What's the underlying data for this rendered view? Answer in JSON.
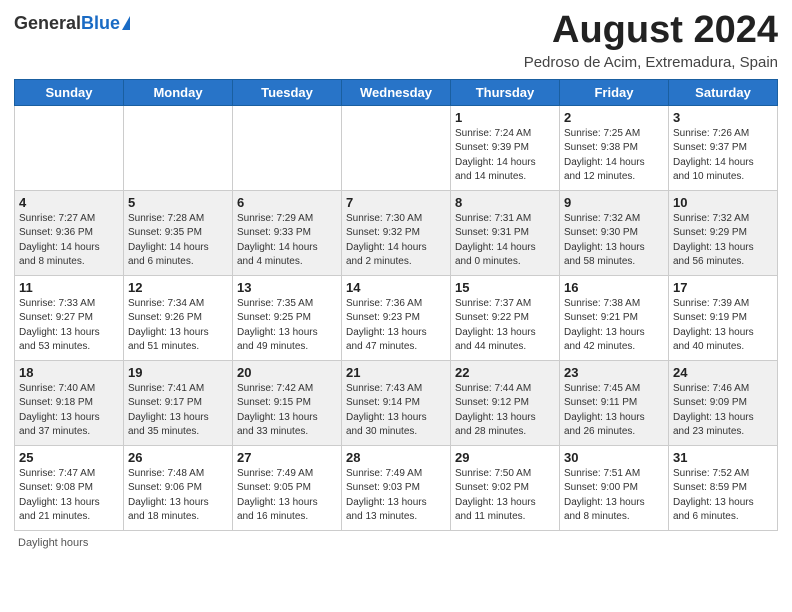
{
  "header": {
    "logo_general": "General",
    "logo_blue": "Blue",
    "month_title": "August 2024",
    "location": "Pedroso de Acim, Extremadura, Spain"
  },
  "days_of_week": [
    "Sunday",
    "Monday",
    "Tuesday",
    "Wednesday",
    "Thursday",
    "Friday",
    "Saturday"
  ],
  "footer": {
    "daylight_label": "Daylight hours"
  },
  "weeks": [
    [
      {
        "day": "",
        "info": ""
      },
      {
        "day": "",
        "info": ""
      },
      {
        "day": "",
        "info": ""
      },
      {
        "day": "",
        "info": ""
      },
      {
        "day": "1",
        "info": "Sunrise: 7:24 AM\nSunset: 9:39 PM\nDaylight: 14 hours\nand 14 minutes."
      },
      {
        "day": "2",
        "info": "Sunrise: 7:25 AM\nSunset: 9:38 PM\nDaylight: 14 hours\nand 12 minutes."
      },
      {
        "day": "3",
        "info": "Sunrise: 7:26 AM\nSunset: 9:37 PM\nDaylight: 14 hours\nand 10 minutes."
      }
    ],
    [
      {
        "day": "4",
        "info": "Sunrise: 7:27 AM\nSunset: 9:36 PM\nDaylight: 14 hours\nand 8 minutes."
      },
      {
        "day": "5",
        "info": "Sunrise: 7:28 AM\nSunset: 9:35 PM\nDaylight: 14 hours\nand 6 minutes."
      },
      {
        "day": "6",
        "info": "Sunrise: 7:29 AM\nSunset: 9:33 PM\nDaylight: 14 hours\nand 4 minutes."
      },
      {
        "day": "7",
        "info": "Sunrise: 7:30 AM\nSunset: 9:32 PM\nDaylight: 14 hours\nand 2 minutes."
      },
      {
        "day": "8",
        "info": "Sunrise: 7:31 AM\nSunset: 9:31 PM\nDaylight: 14 hours\nand 0 minutes."
      },
      {
        "day": "9",
        "info": "Sunrise: 7:32 AM\nSunset: 9:30 PM\nDaylight: 13 hours\nand 58 minutes."
      },
      {
        "day": "10",
        "info": "Sunrise: 7:32 AM\nSunset: 9:29 PM\nDaylight: 13 hours\nand 56 minutes."
      }
    ],
    [
      {
        "day": "11",
        "info": "Sunrise: 7:33 AM\nSunset: 9:27 PM\nDaylight: 13 hours\nand 53 minutes."
      },
      {
        "day": "12",
        "info": "Sunrise: 7:34 AM\nSunset: 9:26 PM\nDaylight: 13 hours\nand 51 minutes."
      },
      {
        "day": "13",
        "info": "Sunrise: 7:35 AM\nSunset: 9:25 PM\nDaylight: 13 hours\nand 49 minutes."
      },
      {
        "day": "14",
        "info": "Sunrise: 7:36 AM\nSunset: 9:23 PM\nDaylight: 13 hours\nand 47 minutes."
      },
      {
        "day": "15",
        "info": "Sunrise: 7:37 AM\nSunset: 9:22 PM\nDaylight: 13 hours\nand 44 minutes."
      },
      {
        "day": "16",
        "info": "Sunrise: 7:38 AM\nSunset: 9:21 PM\nDaylight: 13 hours\nand 42 minutes."
      },
      {
        "day": "17",
        "info": "Sunrise: 7:39 AM\nSunset: 9:19 PM\nDaylight: 13 hours\nand 40 minutes."
      }
    ],
    [
      {
        "day": "18",
        "info": "Sunrise: 7:40 AM\nSunset: 9:18 PM\nDaylight: 13 hours\nand 37 minutes."
      },
      {
        "day": "19",
        "info": "Sunrise: 7:41 AM\nSunset: 9:17 PM\nDaylight: 13 hours\nand 35 minutes."
      },
      {
        "day": "20",
        "info": "Sunrise: 7:42 AM\nSunset: 9:15 PM\nDaylight: 13 hours\nand 33 minutes."
      },
      {
        "day": "21",
        "info": "Sunrise: 7:43 AM\nSunset: 9:14 PM\nDaylight: 13 hours\nand 30 minutes."
      },
      {
        "day": "22",
        "info": "Sunrise: 7:44 AM\nSunset: 9:12 PM\nDaylight: 13 hours\nand 28 minutes."
      },
      {
        "day": "23",
        "info": "Sunrise: 7:45 AM\nSunset: 9:11 PM\nDaylight: 13 hours\nand 26 minutes."
      },
      {
        "day": "24",
        "info": "Sunrise: 7:46 AM\nSunset: 9:09 PM\nDaylight: 13 hours\nand 23 minutes."
      }
    ],
    [
      {
        "day": "25",
        "info": "Sunrise: 7:47 AM\nSunset: 9:08 PM\nDaylight: 13 hours\nand 21 minutes."
      },
      {
        "day": "26",
        "info": "Sunrise: 7:48 AM\nSunset: 9:06 PM\nDaylight: 13 hours\nand 18 minutes."
      },
      {
        "day": "27",
        "info": "Sunrise: 7:49 AM\nSunset: 9:05 PM\nDaylight: 13 hours\nand 16 minutes."
      },
      {
        "day": "28",
        "info": "Sunrise: 7:49 AM\nSunset: 9:03 PM\nDaylight: 13 hours\nand 13 minutes."
      },
      {
        "day": "29",
        "info": "Sunrise: 7:50 AM\nSunset: 9:02 PM\nDaylight: 13 hours\nand 11 minutes."
      },
      {
        "day": "30",
        "info": "Sunrise: 7:51 AM\nSunset: 9:00 PM\nDaylight: 13 hours\nand 8 minutes."
      },
      {
        "day": "31",
        "info": "Sunrise: 7:52 AM\nSunset: 8:59 PM\nDaylight: 13 hours\nand 6 minutes."
      }
    ]
  ]
}
